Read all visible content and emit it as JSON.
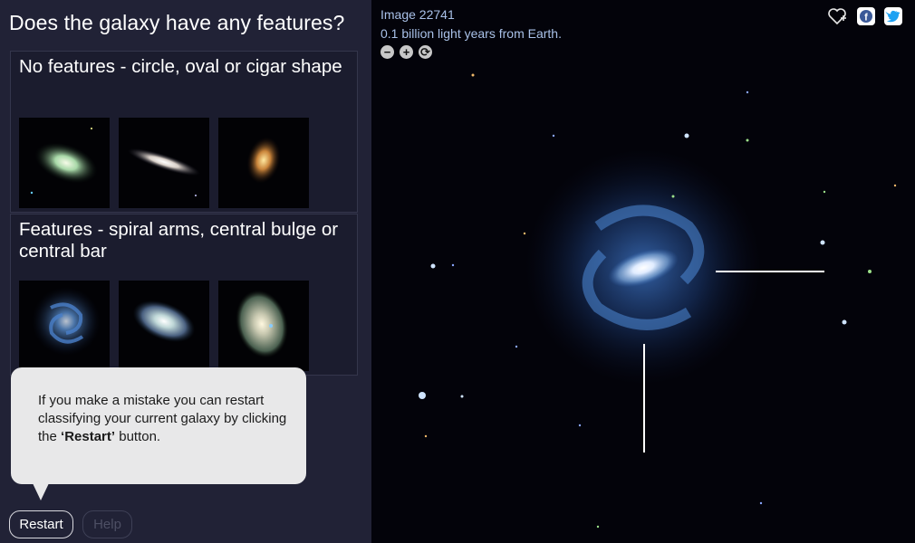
{
  "question": "Does the galaxy have any features?",
  "answers": [
    {
      "label": "No features - circle, oval or cigar shape"
    },
    {
      "label": "Features - spiral arms, central bulge or central bar"
    }
  ],
  "tooltip": {
    "text_before": "If you make a mistake you can restart classifying your current galaxy by clicking the ",
    "text_bold": "‘Restart’",
    "text_after": " button."
  },
  "buttons": {
    "restart": "Restart",
    "help": "Help"
  },
  "viewer": {
    "image_id": "Image 22741",
    "distance": "0.1 billion light years from Earth.",
    "controls": {
      "zoom_out_icon": "−",
      "zoom_in_icon": "+",
      "rotate_icon": "⟳"
    },
    "share_icons": [
      "favorite-icon",
      "facebook-icon",
      "twitter-icon"
    ]
  },
  "colors": {
    "panel": "#212236",
    "accent": "#a9c1e8",
    "facebook": "#3b5998",
    "twitter": "#1da1f2"
  }
}
